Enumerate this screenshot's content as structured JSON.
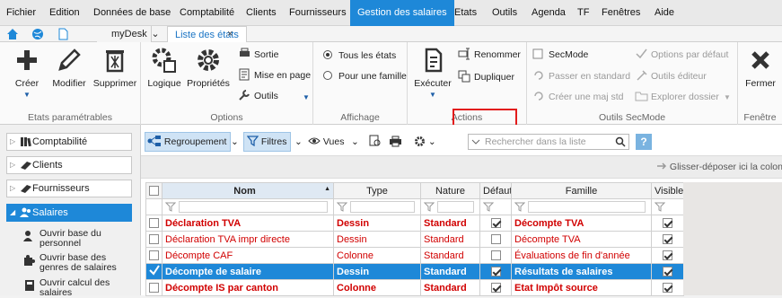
{
  "menubar": {
    "items": [
      "Fichier",
      "Edition",
      "Données de base",
      "Comptabilité",
      "Clients",
      "Fournisseurs",
      "Gestion des salaires",
      "Etats",
      "Outils",
      "Agenda",
      "TF",
      "Fenêtres",
      "Aide"
    ],
    "active_index": 6
  },
  "tabs": {
    "mydesk_label": "myDesk",
    "active_label": "Liste des états",
    "close_glyph": "×"
  },
  "ribbon": {
    "groups": {
      "etats_parametrables": {
        "label": "Etats paramétrables",
        "creer": "Créer",
        "modifier": "Modifier",
        "supprimer": "Supprimer"
      },
      "options": {
        "label": "Options",
        "logique": "Logique",
        "proprietes": "Propriétés",
        "sortie": "Sortie",
        "mise_en_page": "Mise en page",
        "outils": "Outils"
      },
      "affichage": {
        "label": "Affichage",
        "tous_les_etats": "Tous les états",
        "pour_une_famille": "Pour une famille"
      },
      "actions": {
        "label": "Actions",
        "executer": "Exécuter",
        "renommer": "Renommer",
        "dupliquer": "Dupliquer"
      },
      "outils_secmode": {
        "label": "Outils SecMode",
        "secmode": "SecMode",
        "passer_en_standard": "Passer en standard",
        "creer_une_maj_std": "Créer une maj std",
        "options_par_defaut": "Options par défaut",
        "outils_editeur": "Outils éditeur",
        "explorer_dossier": "Explorer dossier"
      },
      "fenetre": {
        "label": "Fenêtre",
        "fermer": "Fermer"
      }
    }
  },
  "navigation": {
    "items": [
      {
        "label": "Comptabilité",
        "icon": "books-icon"
      },
      {
        "label": "Clients",
        "icon": "book-icon"
      },
      {
        "label": "Fournisseurs",
        "icon": "book-icon"
      },
      {
        "label": "Salaires",
        "icon": "people-icon"
      }
    ],
    "selected_index": 3,
    "sub_items": [
      "Ouvrir base du personnel",
      "Ouvrir base des genres de salaires",
      "Ouvrir calcul des salaires"
    ]
  },
  "list_toolbar": {
    "regroupement": "Regroupement",
    "filtres": "Filtres",
    "vues": "Vues",
    "search_placeholder": "Rechercher dans la liste",
    "help": "?",
    "drag_hint": "Glisser-déposer ici la colonne"
  },
  "table": {
    "columns": [
      "Nom",
      "Type",
      "Nature",
      "Défaut",
      "Famille",
      "Visible"
    ],
    "rows": [
      {
        "nom": "Déclaration TVA",
        "type": "Dessin",
        "nature": "Standard",
        "defaut": true,
        "famille": "Décompte TVA",
        "visible": true,
        "style": "red-bold"
      },
      {
        "nom": "Déclaration TVA impr directe",
        "type": "Dessin",
        "nature": "Standard",
        "defaut": false,
        "famille": "Décompte TVA",
        "visible": true,
        "style": "red"
      },
      {
        "nom": "Décompte CAF",
        "type": "Colonne",
        "nature": "Standard",
        "defaut": false,
        "famille": "Évaluations de fin d'année",
        "visible": true,
        "style": "red"
      },
      {
        "nom": "Décompte de salaire",
        "type": "Dessin",
        "nature": "Standard",
        "defaut": true,
        "famille": "Résultats de salaires",
        "visible": true,
        "style": "selected"
      },
      {
        "nom": "Décompte IS par canton",
        "type": "Colonne",
        "nature": "Standard",
        "defaut": true,
        "famille": "Etat Impôt source",
        "visible": true,
        "style": "red-bold"
      }
    ]
  },
  "colors": {
    "accent": "#1e88d8",
    "highlight_border": "#e21b1b",
    "row_text_red": "#d10000"
  }
}
